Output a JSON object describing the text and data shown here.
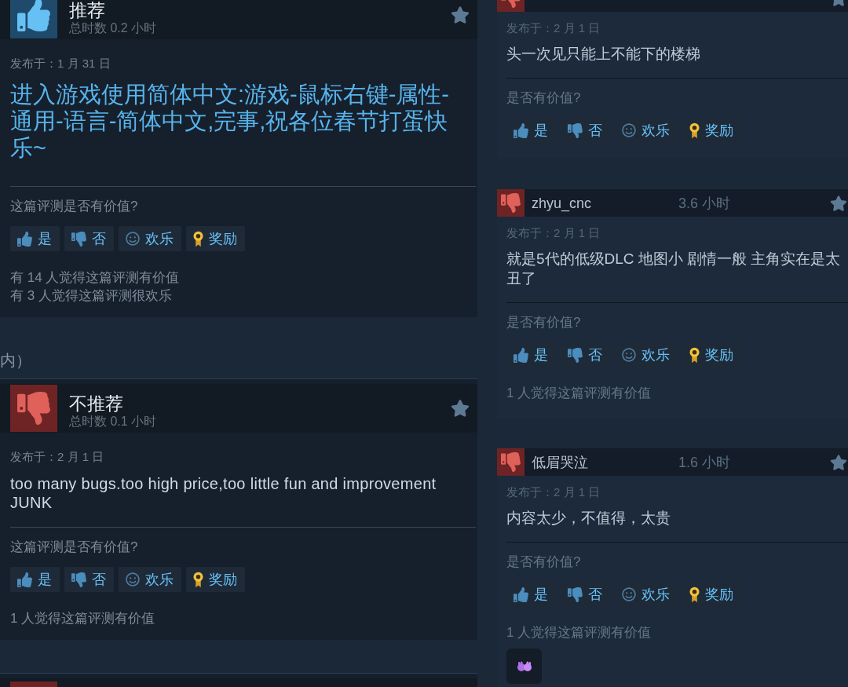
{
  "left_column": {
    "items": [
      {
        "kind": "review",
        "recommended": true,
        "verdict": "推荐",
        "playtime": "总时数 0.2 小时",
        "posted": "发布于：1 月 31 日",
        "text": "进入游戏使用简体中文:游戏-鼠标右键-属性-通用-语言-简体中文,完事,祝各位春节打蛋快乐~",
        "emphasized": true,
        "helpful_prompt": "这篇评测是否有价值?",
        "buttons": [
          {
            "kind": "yes",
            "label": "是"
          },
          {
            "kind": "no",
            "label": "否"
          },
          {
            "kind": "funny",
            "label": "欢乐"
          },
          {
            "kind": "award",
            "label": "奖励"
          }
        ],
        "stats": [
          "有 14 人觉得这篇评测有价值",
          "有 3 人觉得这篇评测很欢乐"
        ]
      },
      {
        "kind": "section_heading",
        "text": "内）"
      },
      {
        "kind": "review",
        "recommended": false,
        "verdict": "不推荐",
        "playtime": "总时数 0.1 小时",
        "posted": "发布于：2 月 1 日",
        "text": "too many bugs.too high price,too little fun and improvement JUNK",
        "emphasized": false,
        "helpful_prompt": "这篇评测是否有价值?",
        "buttons": [
          {
            "kind": "yes",
            "label": "是"
          },
          {
            "kind": "no",
            "label": "否"
          },
          {
            "kind": "funny",
            "label": "欢乐"
          },
          {
            "kind": "award",
            "label": "奖励"
          }
        ],
        "stats": [
          "1 人觉得这篇评测有价值"
        ]
      },
      {
        "kind": "review_cut",
        "recommended": false
      }
    ]
  },
  "right_column": {
    "items": [
      {
        "kind": "review",
        "recommended": false,
        "posted": "发布于：2 月 1 日",
        "text": "头一次见只能上不能下的楼梯",
        "emphasized": false,
        "helpful_prompt": "是否有价值?",
        "buttons": [
          {
            "kind": "yes",
            "label": "是"
          },
          {
            "kind": "no",
            "label": "否"
          },
          {
            "kind": "funny",
            "label": "欢乐"
          },
          {
            "kind": "award",
            "label": "奖励"
          }
        ],
        "awarded": false
      },
      {
        "kind": "review",
        "recommended": false,
        "user": "zhyu_cnc",
        "playtime": "3.6 小时",
        "posted": "发布于：2 月 1 日",
        "text": "就是5代的低级DLC 地图小 剧情一般 主角实在是太丑了",
        "emphasized": false,
        "helpful_prompt": "是否有价值?",
        "buttons": [
          {
            "kind": "yes",
            "label": "是"
          },
          {
            "kind": "no",
            "label": "否"
          },
          {
            "kind": "funny",
            "label": "欢乐"
          },
          {
            "kind": "award",
            "label": "奖励"
          }
        ],
        "stats": [
          "1 人觉得这篇评测有价值"
        ],
        "awarded": false
      },
      {
        "kind": "review",
        "recommended": false,
        "user": "低眉哭泣",
        "playtime": "1.6 小时",
        "posted": "发布于：2 月 1 日",
        "text": "内容太少，不值得，太贵",
        "emphasized": false,
        "helpful_prompt": "是否有价值?",
        "buttons": [
          {
            "kind": "yes",
            "label": "是"
          },
          {
            "kind": "no",
            "label": "否"
          },
          {
            "kind": "funny",
            "label": "欢乐"
          },
          {
            "kind": "award",
            "label": "奖励"
          }
        ],
        "stats": [
          "1 人觉得这篇评测有价值"
        ],
        "awarded": true
      }
    ]
  }
}
